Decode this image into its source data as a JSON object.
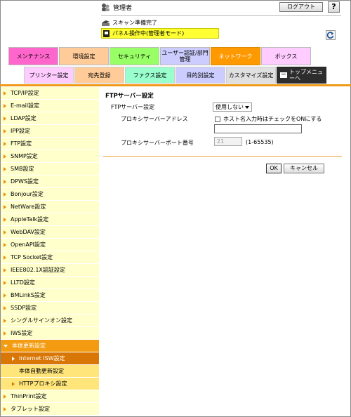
{
  "header": {
    "user_label": "管理者",
    "logout_label": "ログアウト",
    "help_label": "?",
    "status_scan": "スキャン準備完了",
    "status_panel": "パネル操作中(管理者モード)"
  },
  "categories": [
    {
      "label": "メンテナンス",
      "color": "#ff66cc"
    },
    {
      "label": "環境設定",
      "color": "#ffcc99"
    },
    {
      "label": "セキュリティ",
      "color": "#99ff66"
    },
    {
      "label": "ユーザー認証/部門管理",
      "color": "#ccccff"
    },
    {
      "label": "ネットワーク",
      "color": "#ff9900",
      "selected": true
    },
    {
      "label": "ボックス",
      "color": "#ffccff"
    }
  ],
  "subtabs": [
    {
      "label": "プリンター設定",
      "color": "#ffccff"
    },
    {
      "label": "宛先登録",
      "color": "#ffcc99"
    },
    {
      "label": "ファクス設定",
      "color": "#99ffcc"
    },
    {
      "label": "目的別設定",
      "color": "#ccccff"
    },
    {
      "label": "カスタマイズ設定",
      "color": "#e0e0e0"
    },
    {
      "label": "トップメニューへ"
    }
  ],
  "sidebar": {
    "items": [
      "TCP/IP設定",
      "E-mail設定",
      "LDAP設定",
      "IPP設定",
      "FTP設定",
      "SNMP設定",
      "SMB設定",
      "DPWS設定",
      "Bonjour設定",
      "NetWare設定",
      "AppleTalk設定",
      "WebDAV設定",
      "OpenAPI設定",
      "TCP Socket設定",
      "IEEE802.1X認証設定",
      "LLTD設定",
      "BMLinkS設定",
      "SSDP設定",
      "シングルサインオン設定",
      "IWS設定"
    ],
    "open_item": "本体更新設定",
    "sub_items": [
      "Internet ISW設定",
      "本体自動更新設定",
      "HTTPプロキシ設定"
    ],
    "after_items": [
      "ThinPrint設定",
      "タブレット設定"
    ]
  },
  "main": {
    "title": "FTPサーバー設定",
    "ftp_server_label": "FTPサーバー設定",
    "ftp_server_value": "使用しない",
    "proxy_address_label": "プロキシサーバーアドレス",
    "host_checkbox_label": "ホスト名入力時はチェックをONにする",
    "proxy_address_value": "",
    "proxy_port_label": "プロキシサーバーポート番号",
    "proxy_port_value": "21",
    "port_range": "(1-65535)",
    "ok_label": "OK",
    "cancel_label": "キャンセル"
  },
  "colors": {
    "accent": "#f19a1a",
    "sidebar_bg": "#ffffcc",
    "sidebar_open": "#f39c12",
    "sidebar_sub": "#ffe57a",
    "sidebar_sub_selected": "#d97706",
    "panel_status": "#ffff33"
  }
}
